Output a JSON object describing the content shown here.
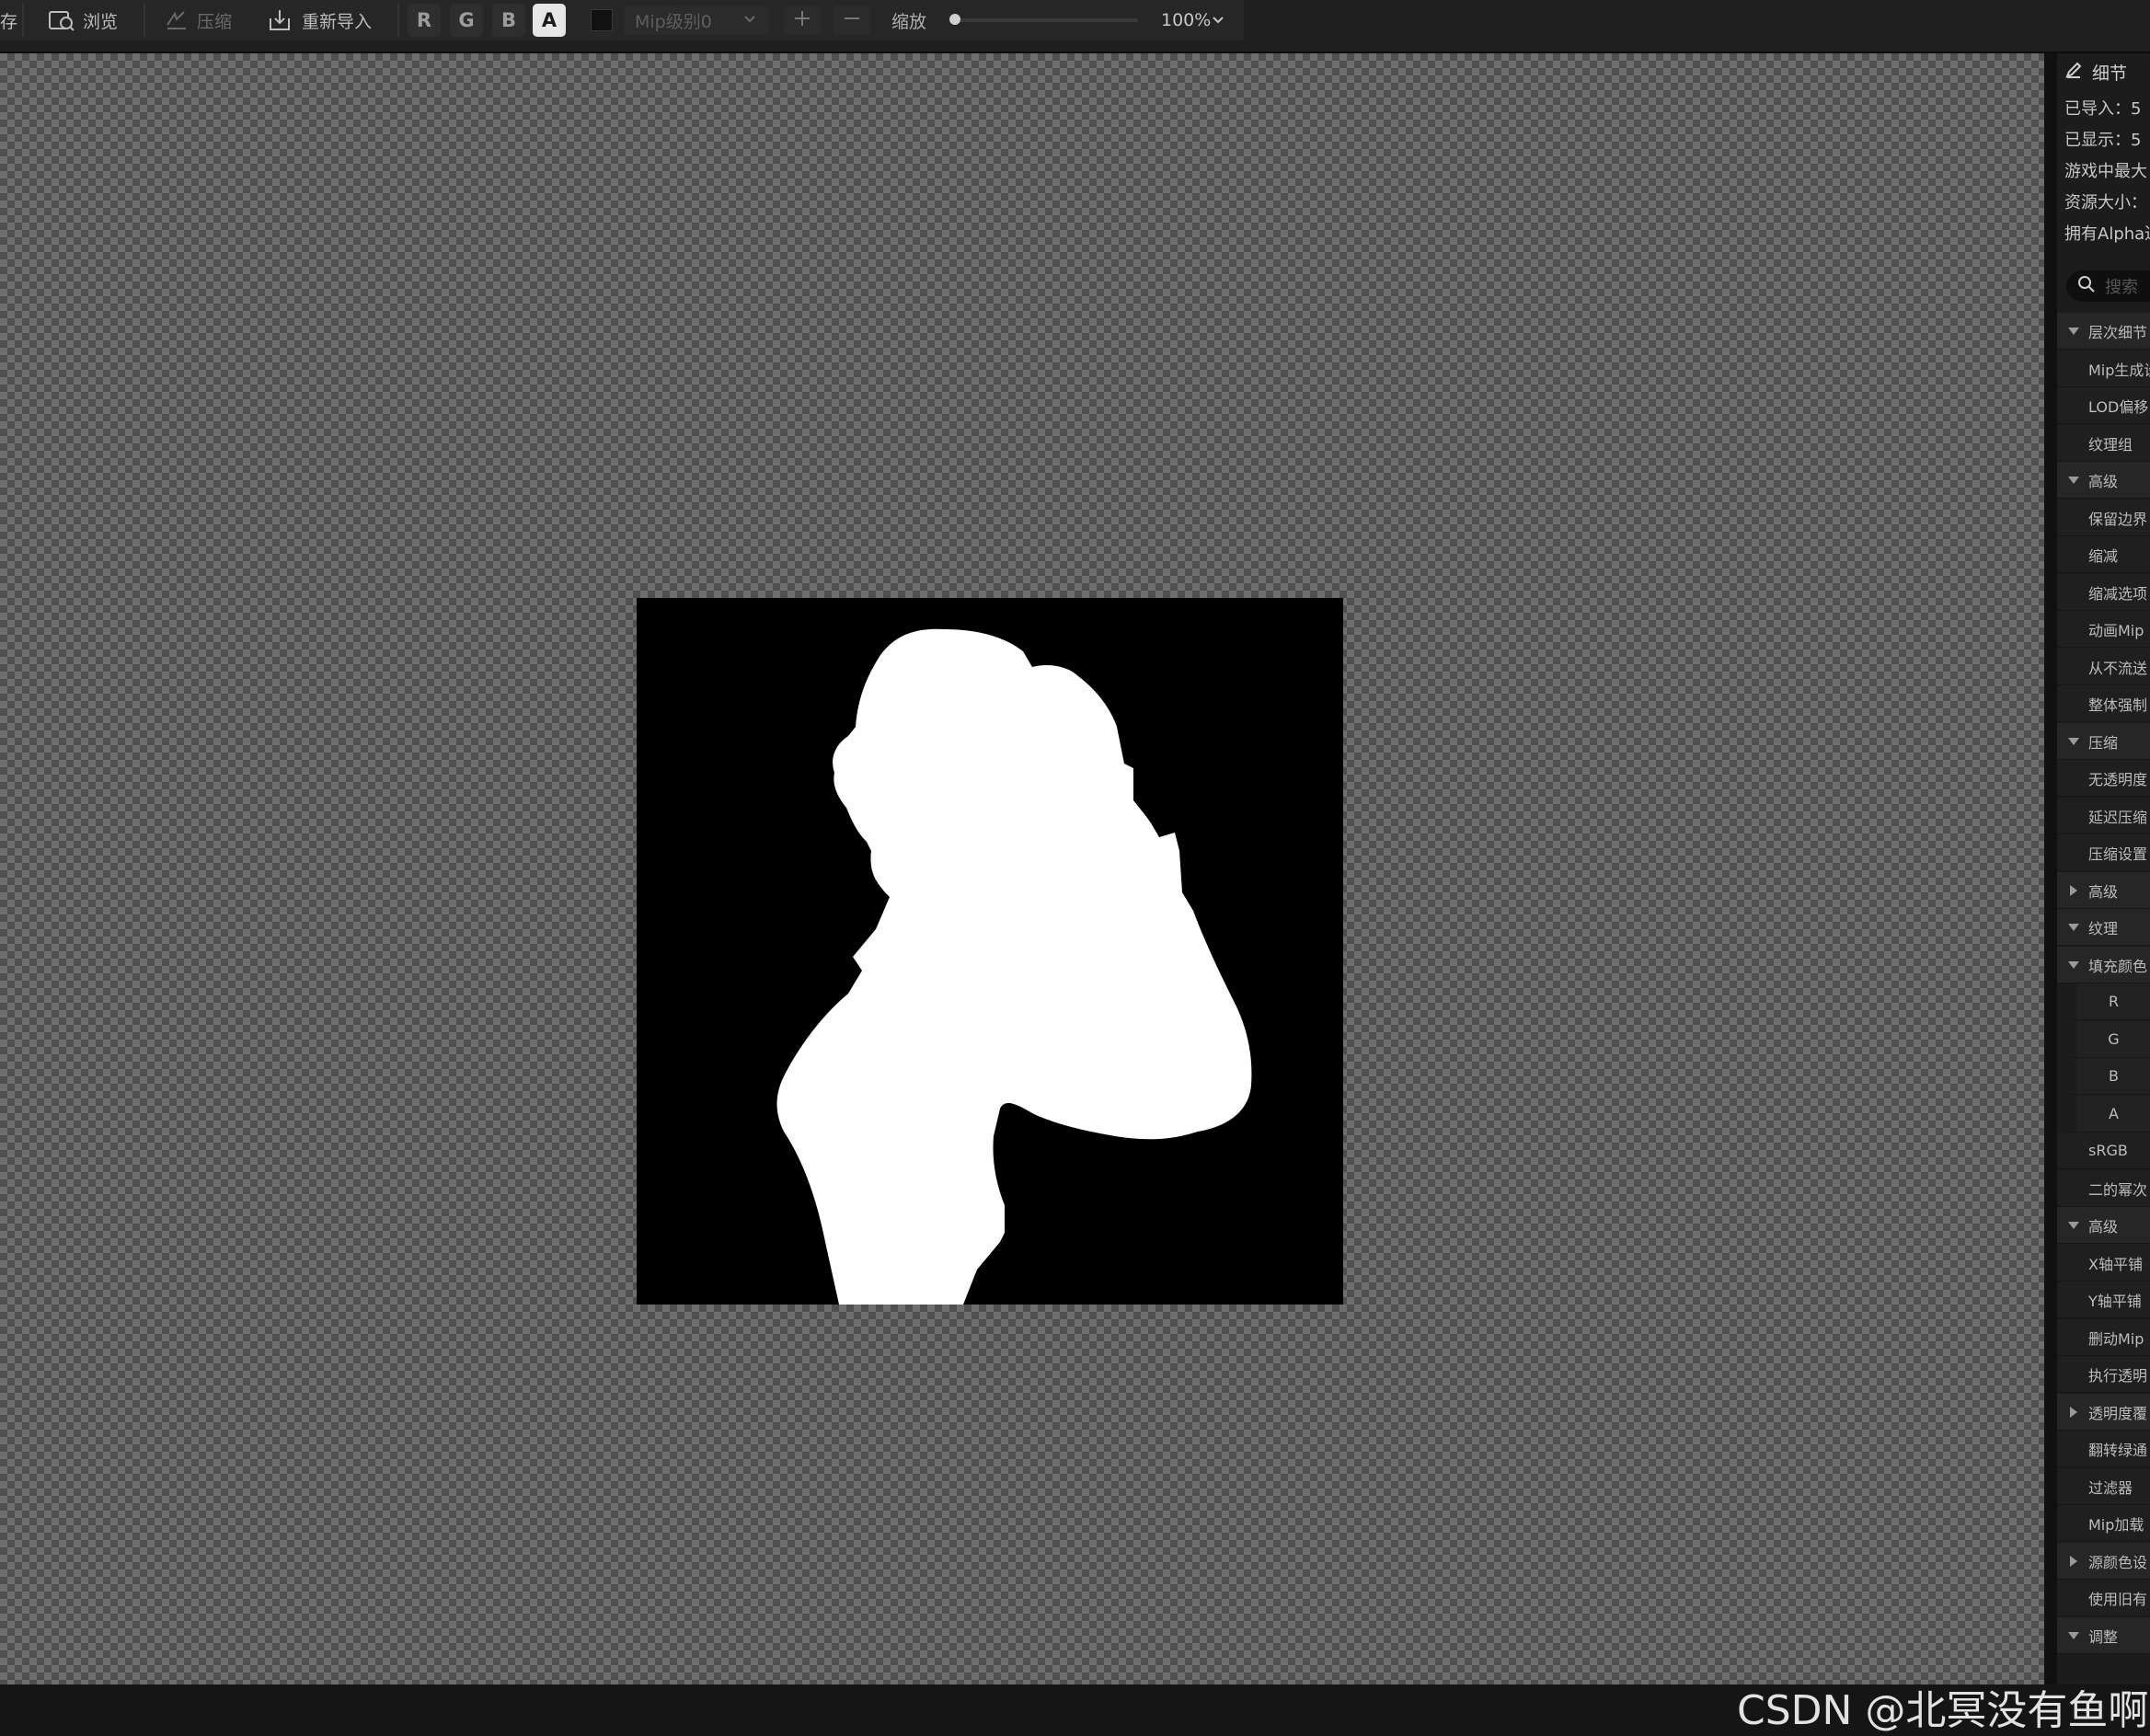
{
  "toolbar": {
    "save_label": "存",
    "browse_label": "浏览",
    "compress_label": "压缩",
    "reimport_label": "重新导入",
    "channel_r": "R",
    "channel_g": "G",
    "channel_b": "B",
    "channel_a": "A",
    "active_channel": "A",
    "mip_select_value": "Mip级别0",
    "zoom_label": "缩放",
    "zoom_value": "100%",
    "zoom_level_fraction": 0.0
  },
  "viewport": {
    "watermark": "CSDN @北冥没有鱼啊"
  },
  "details": {
    "title": "细节",
    "info": [
      "已导入：5",
      "已显示：5",
      "游戏中最大",
      "资源大小：",
      "拥有Alpha通"
    ],
    "search_placeholder": "搜索",
    "rows": [
      {
        "label": "层次细节",
        "kind": "cat",
        "arrow": "down"
      },
      {
        "label": "Mip生成设",
        "kind": "sub"
      },
      {
        "label": "LOD偏移",
        "kind": "sub"
      },
      {
        "label": "纹理组",
        "kind": "sub"
      },
      {
        "label": "高级",
        "kind": "cat",
        "arrow": "down"
      },
      {
        "label": "保留边界",
        "kind": "sub"
      },
      {
        "label": "缩减",
        "kind": "sub"
      },
      {
        "label": "缩减选项",
        "kind": "sub"
      },
      {
        "label": "动画Mip",
        "kind": "sub"
      },
      {
        "label": "从不流送",
        "kind": "sub"
      },
      {
        "label": "整体强制",
        "kind": "sub"
      },
      {
        "label": "压缩",
        "kind": "cat",
        "arrow": "down"
      },
      {
        "label": "无透明度",
        "kind": "sub"
      },
      {
        "label": "延迟压缩",
        "kind": "sub"
      },
      {
        "label": "压缩设置",
        "kind": "sub"
      },
      {
        "label": "高级",
        "kind": "cat",
        "arrow": "right"
      },
      {
        "label": "纹理",
        "kind": "cat",
        "arrow": "down"
      },
      {
        "label": "填充颜色",
        "kind": "cat",
        "arrow": "down"
      },
      {
        "label": "R",
        "kind": "chan"
      },
      {
        "label": "G",
        "kind": "chan"
      },
      {
        "label": "B",
        "kind": "chan"
      },
      {
        "label": "A",
        "kind": "chan"
      },
      {
        "label": "sRGB",
        "kind": "sub"
      },
      {
        "label": "二的幂次",
        "kind": "sub"
      },
      {
        "label": "高级",
        "kind": "cat",
        "arrow": "down"
      },
      {
        "label": "X轴平铺",
        "kind": "sub"
      },
      {
        "label": "Y轴平铺",
        "kind": "sub"
      },
      {
        "label": "删动Mip",
        "kind": "sub"
      },
      {
        "label": "执行透明",
        "kind": "sub"
      },
      {
        "label": "透明度覆",
        "kind": "cat",
        "arrow": "right"
      },
      {
        "label": "翻转绿通",
        "kind": "sub"
      },
      {
        "label": "过滤器",
        "kind": "sub"
      },
      {
        "label": "Mip加载",
        "kind": "sub"
      },
      {
        "label": "源颜色设",
        "kind": "cat",
        "arrow": "right"
      },
      {
        "label": "使用旧有",
        "kind": "sub"
      },
      {
        "label": "调整",
        "kind": "cat",
        "arrow": "down"
      }
    ]
  },
  "colors": {
    "toolbar_bg": "#1f1f1f",
    "active_channel_bg": "#e6e6e6",
    "checker_light": "#6e6e6e",
    "checker_dark": "#4f4f4f",
    "panel_bg": "#1c1c1c"
  },
  "icons": [
    "browse-icon",
    "compress-icon",
    "reimport-icon",
    "plus-icon",
    "minus-icon",
    "chevron-down-icon",
    "edit-icon",
    "search-icon"
  ]
}
